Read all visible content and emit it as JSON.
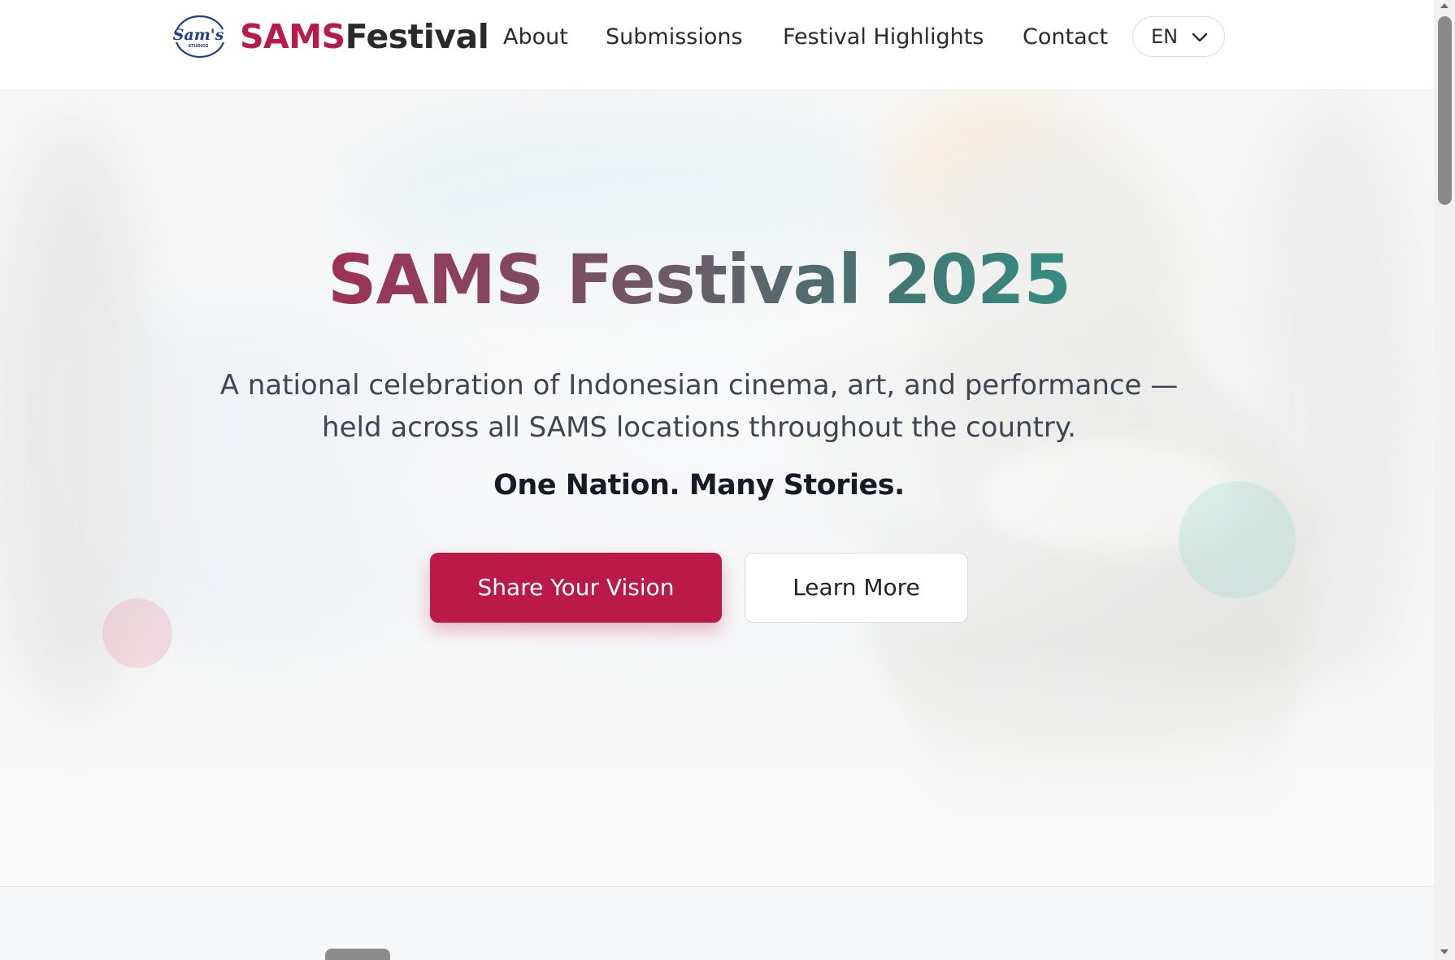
{
  "header": {
    "logo_text": "Sam's",
    "logo_subtext": "STUDIOS",
    "brand_part1": "SAMS",
    "brand_part2": "Festival",
    "nav": [
      {
        "label": "About"
      },
      {
        "label": "Submissions"
      },
      {
        "label": "Festival Highlights"
      },
      {
        "label": "Contact"
      }
    ],
    "language": {
      "selected": "EN",
      "icon": "chevron-down-icon"
    }
  },
  "hero": {
    "title": "SAMS Festival 2025",
    "subtitle": "A national celebration of Indonesian cinema, art, and performance — held across all SAMS locations throughout the country.",
    "tagline": "One Nation. Many Stories.",
    "primary_button": "Share Your Vision",
    "secondary_button": "Learn More"
  },
  "colors": {
    "accent": "#bb1a48",
    "teal": "#1fb89a",
    "text_dark": "#151a24"
  }
}
